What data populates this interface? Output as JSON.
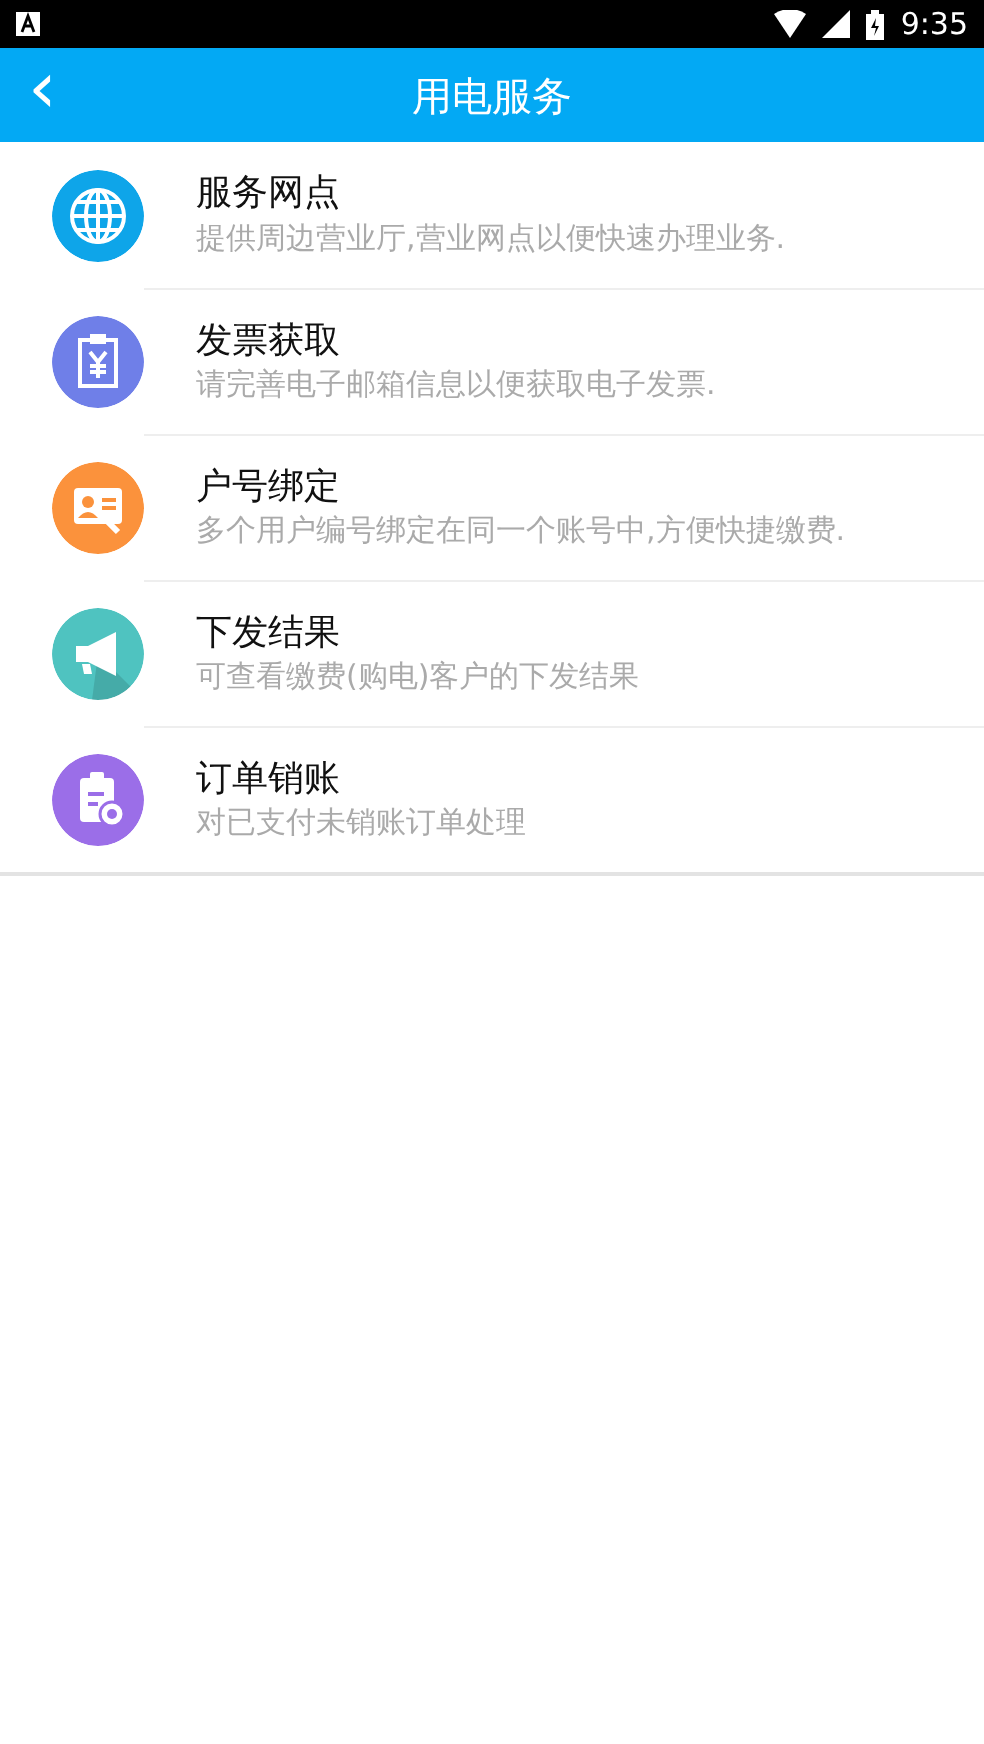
{
  "status_bar": {
    "time": "9:35"
  },
  "header": {
    "back": "‹",
    "title": "用电服务"
  },
  "items": [
    {
      "kind": "globe",
      "color": "#0ea5e9",
      "title": "服务网点",
      "subtitle": "提供周边营业厅,营业网点以便快速办理业务."
    },
    {
      "kind": "invoice",
      "color": "#6f7fe8",
      "title": "发票获取",
      "subtitle": "请完善电子邮箱信息以便获取电子发票."
    },
    {
      "kind": "idcard",
      "color": "#fb923c",
      "title": "户号绑定",
      "subtitle": "多个用户编号绑定在同一个账号中,方便快捷缴费."
    },
    {
      "kind": "megaphone",
      "color": "#4fc3c0",
      "title": "下发结果",
      "subtitle": "可查看缴费(购电)客户的下发结果"
    },
    {
      "kind": "clipboard",
      "color": "#9b6ee8",
      "title": "订单销账",
      "subtitle": "对已支付未销账订单处理"
    }
  ]
}
